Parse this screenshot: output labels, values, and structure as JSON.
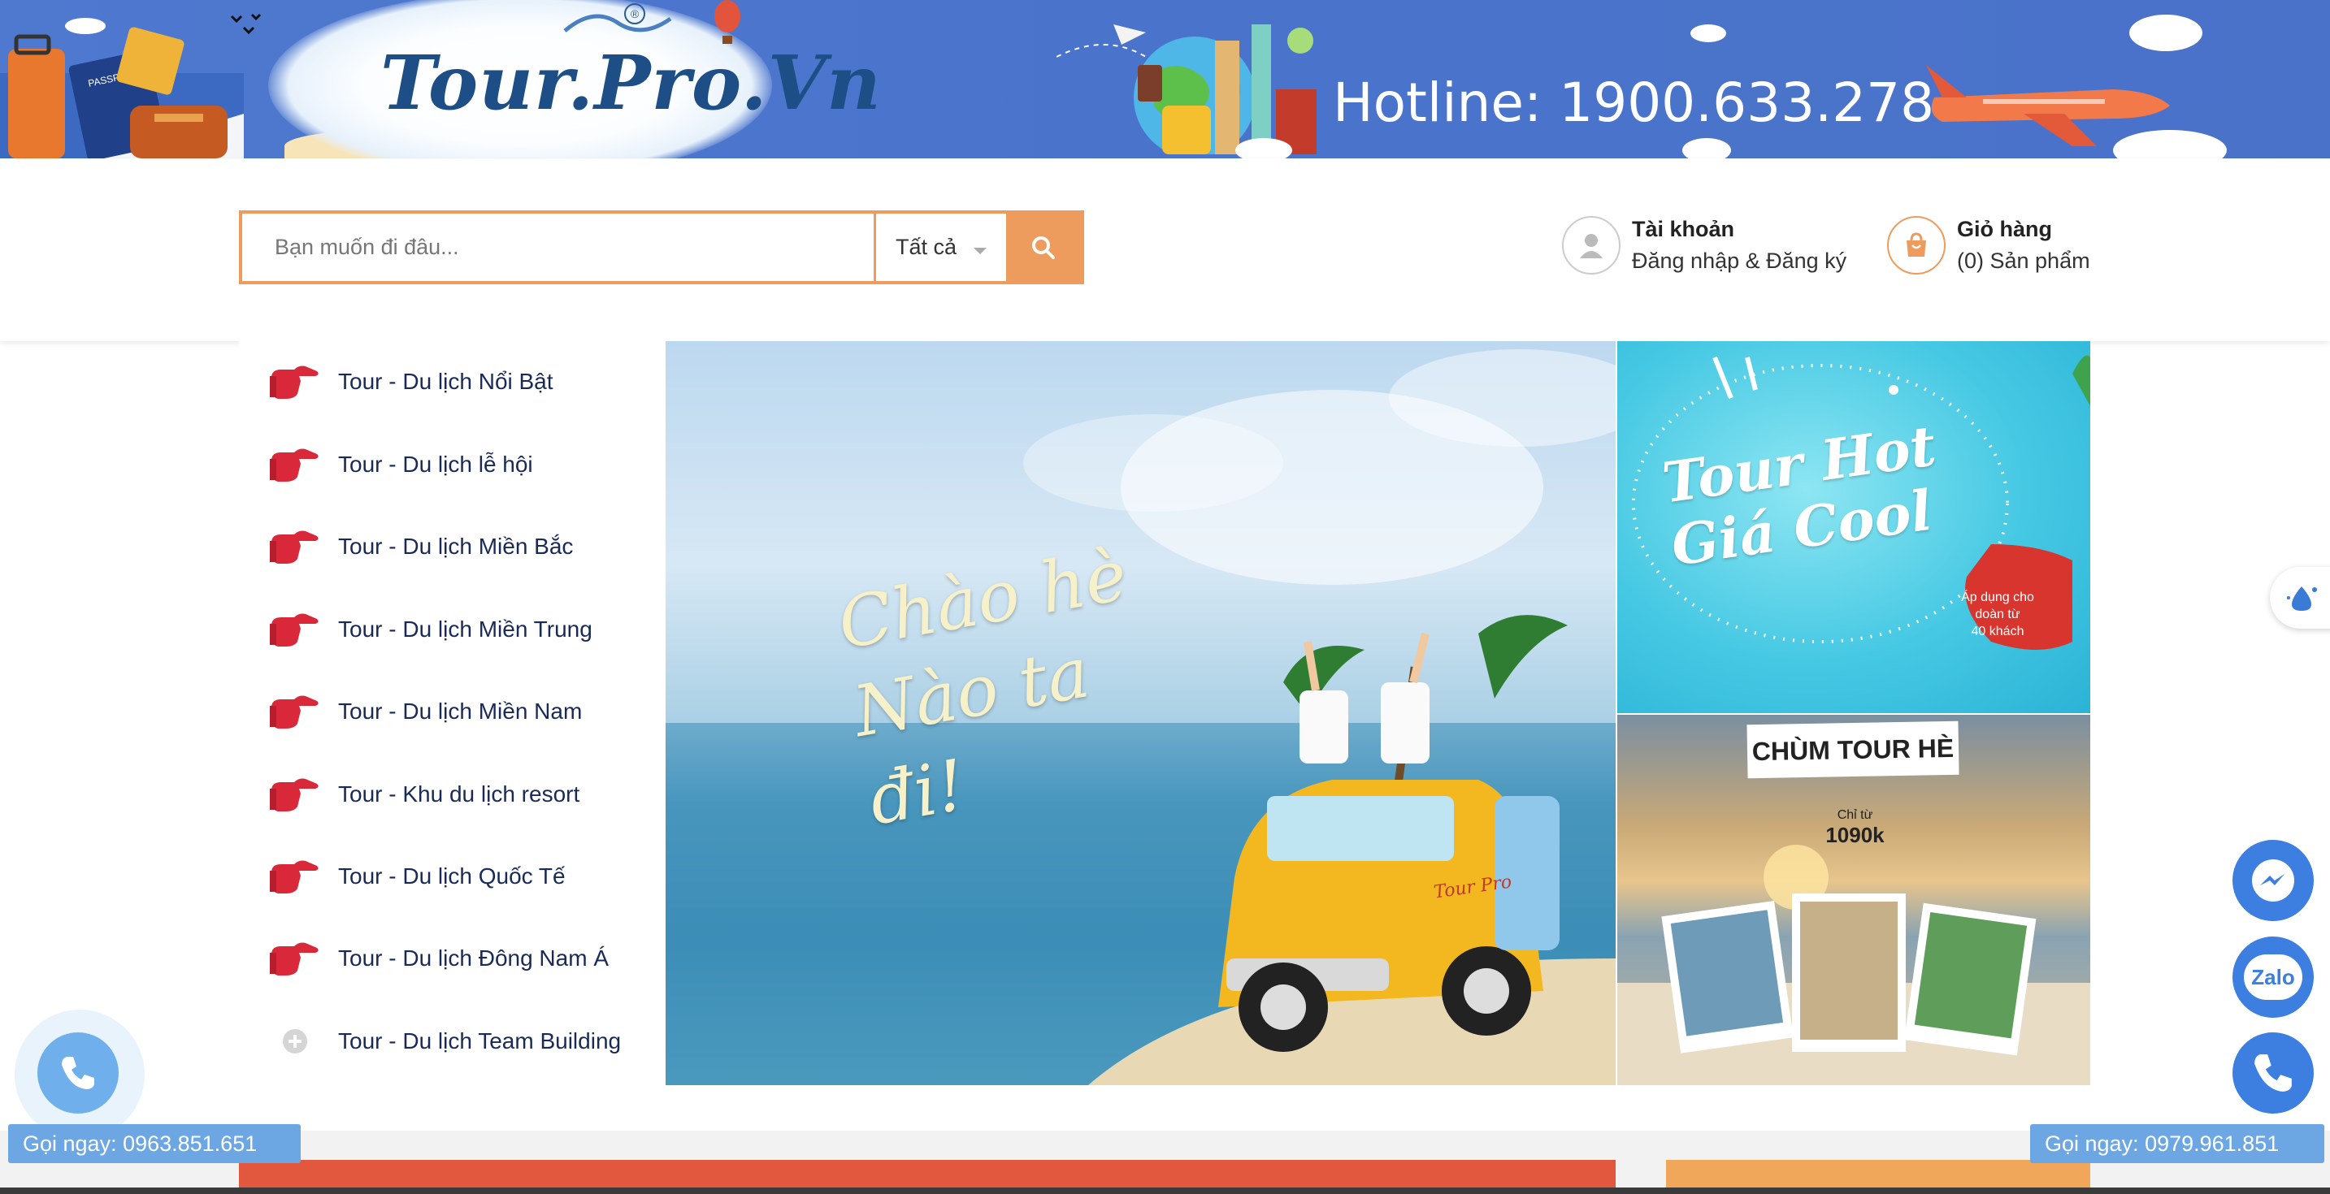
{
  "header": {
    "logo_text": "Tour.Pro.Vn",
    "registered_mark": "®",
    "hotline": "Hotline: 1900.633.278"
  },
  "search": {
    "placeholder": "Bạn muốn đi đâu...",
    "category": "Tất cả"
  },
  "account": {
    "title": "Tài khoản",
    "subtitle": "Đăng nhập & Đăng ký"
  },
  "cart": {
    "title": "Giỏ hàng",
    "subtitle": "(0) Sản phẩm"
  },
  "sidebar": {
    "items": [
      {
        "label": "Tour - Du lịch Nổi Bật",
        "icon": "pointing-hand-icon"
      },
      {
        "label": "Tour - Du lịch lễ hội",
        "icon": "pointing-hand-icon"
      },
      {
        "label": "Tour - Du lịch Miền Bắc",
        "icon": "pointing-hand-icon"
      },
      {
        "label": "Tour - Du lịch Miền Trung",
        "icon": "pointing-hand-icon"
      },
      {
        "label": "Tour - Du lịch Miền Nam",
        "icon": "pointing-hand-icon"
      },
      {
        "label": "Tour - Khu du lịch resort",
        "icon": "pointing-hand-icon"
      },
      {
        "label": "Tour - Du lịch Quốc Tế",
        "icon": "pointing-hand-icon"
      },
      {
        "label": "Tour - Du lịch Đông Nam Á",
        "icon": "pointing-hand-icon"
      },
      {
        "label": "Tour - Du lịch Team Building",
        "icon": "plus-circle-icon"
      }
    ]
  },
  "banners": {
    "main_script": "Chào hè\nNào ta đi!",
    "main_car_brand": "Tour Pro",
    "hot_title": "Tour Hot\nGiá Cool",
    "hot_badge": "Áp dụng cho\ndoàn từ\n40 khách",
    "summer_title": "CHÙM TOUR HÈ",
    "summer_price_prefix": "Chỉ từ",
    "summer_price": "1090k"
  },
  "floating": {
    "call_left": "Gọi ngay: 0963.851.651",
    "call_right": "Gọi ngay: 0979.961.851",
    "zalo_label": "Zalo"
  },
  "colors": {
    "accent_orange": "#ee9b5e",
    "banner_blue": "#4f79cf",
    "hand_red": "#d9283a",
    "chip_blue": "#6da7e3",
    "bar_red": "#e1583f"
  }
}
